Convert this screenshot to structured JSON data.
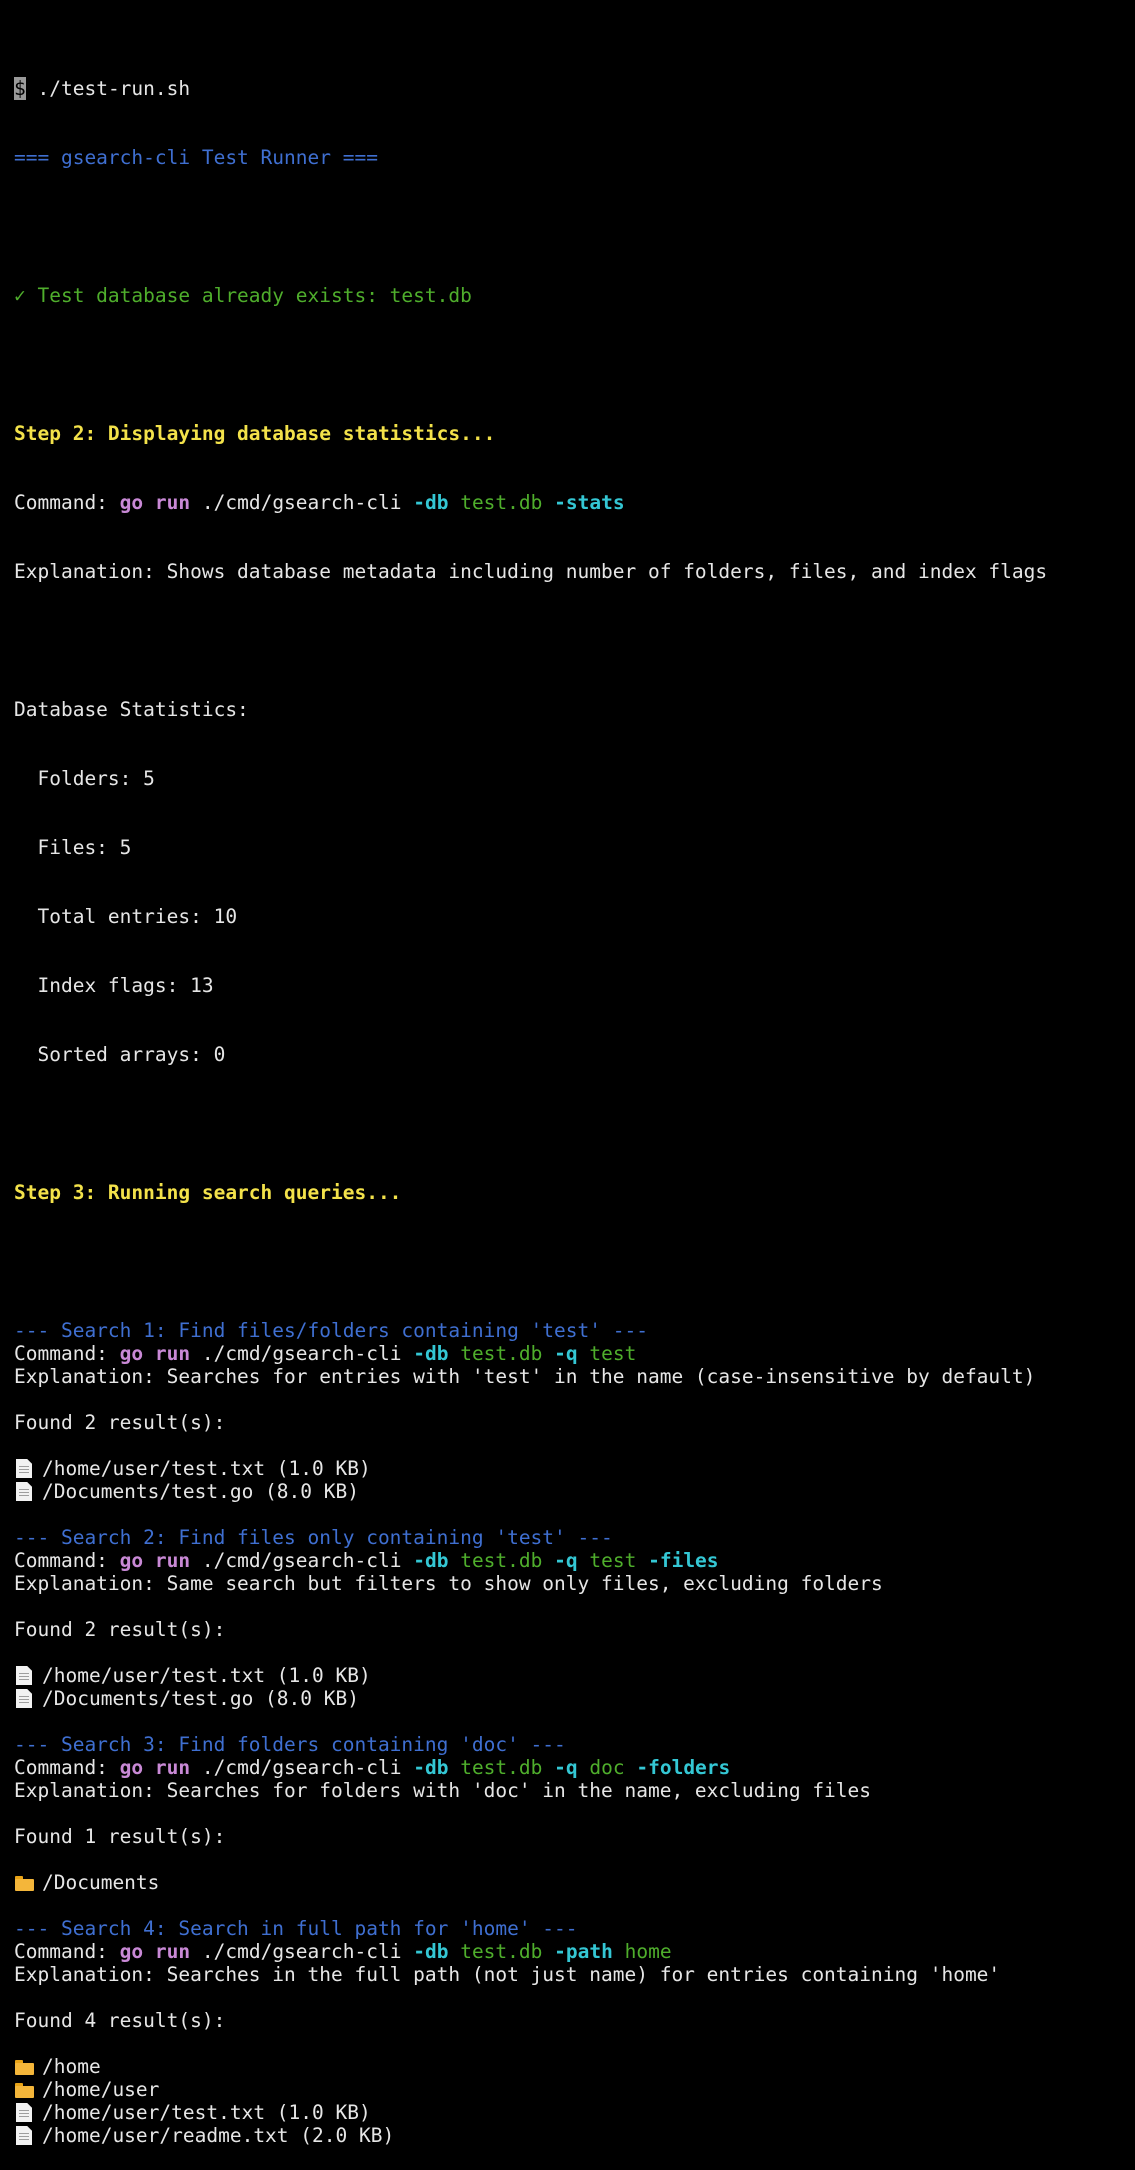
{
  "prompt": {
    "symbol": "$",
    "command": "./test-run.sh"
  },
  "header": "=== gsearch-cli Test Runner ===",
  "db_exists": "✓ Test database already exists: test.db",
  "cmd_label": "Command:",
  "go_kw": "go run",
  "bin_path": "./cmd/gsearch-cli",
  "db_flag": "-db",
  "db_arg": "test.db",
  "step2": {
    "title": "Step 2: Displaying database statistics...",
    "flag": "-stats",
    "explanation": "Explanation: Shows database metadata including number of folders, files, and index flags"
  },
  "stats": {
    "title": "Database Statistics:",
    "lines": [
      "  Folders: 5",
      "  Files: 5",
      "  Total entries: 10",
      "  Index flags: 13",
      "  Sorted arrays: 0"
    ]
  },
  "step3": {
    "title": "Step 3: Running search queries..."
  },
  "searches": [
    {
      "title": "--- Search 1: Find files/folders containing 'test' ---",
      "flag1": "-q",
      "arg1": "test",
      "flag2": "",
      "explanation": "Explanation: Searches for entries with 'test' in the name (case-insensitive by default)",
      "found": "Found 2 result(s):",
      "results": [
        {
          "icon": "file-icon",
          "text": "/home/user/test.txt (1.0 KB)"
        },
        {
          "icon": "file-icon",
          "text": "/Documents/test.go (8.0 KB)"
        }
      ]
    },
    {
      "title": "--- Search 2: Find files only containing 'test' ---",
      "flag1": "-q",
      "arg1": "test",
      "flag2": "-files",
      "explanation": "Explanation: Same search but filters to show only files, excluding folders",
      "found": "Found 2 result(s):",
      "results": [
        {
          "icon": "file-icon",
          "text": "/home/user/test.txt (1.0 KB)"
        },
        {
          "icon": "file-icon",
          "text": "/Documents/test.go (8.0 KB)"
        }
      ]
    },
    {
      "title": "--- Search 3: Find folders containing 'doc' ---",
      "flag1": "-q",
      "arg1": "doc",
      "flag2": "-folders",
      "explanation": "Explanation: Searches for folders with 'doc' in the name, excluding files",
      "found": "Found 1 result(s):",
      "results": [
        {
          "icon": "folder-icon",
          "text": "/Documents"
        }
      ]
    },
    {
      "title": "--- Search 4: Search in full path for 'home' ---",
      "flag1": "-path",
      "arg1": "home",
      "flag2": "",
      "explanation": "Explanation: Searches in the full path (not just name) for entries containing 'home'",
      "found": "Found 4 result(s):",
      "results": [
        {
          "icon": "folder-icon",
          "text": "/home"
        },
        {
          "icon": "folder-icon",
          "text": "/home/user"
        },
        {
          "icon": "file-icon",
          "text": "/home/user/test.txt (1.0 KB)"
        },
        {
          "icon": "file-icon",
          "text": "/home/user/readme.txt (2.0 KB)"
        }
      ]
    }
  ]
}
